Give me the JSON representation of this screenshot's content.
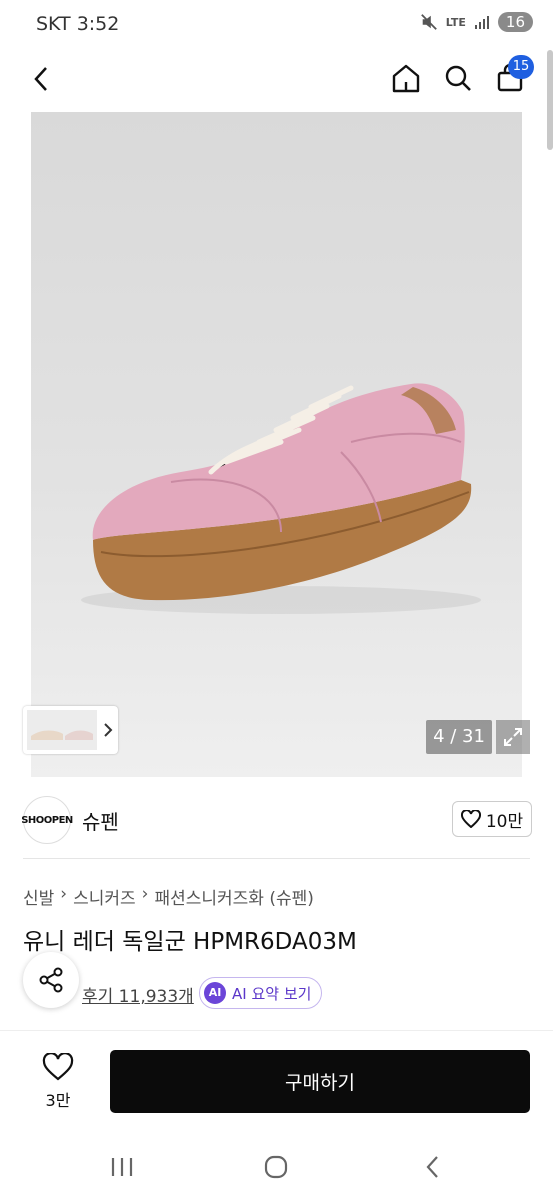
{
  "status_bar": {
    "carrier_time": "SKT 3:52",
    "network": "LTE",
    "battery": "16"
  },
  "header": {
    "cart_count": "15"
  },
  "gallery": {
    "counter": "4 / 31"
  },
  "brand": {
    "logo_text": "SHOOPEN",
    "name": "슈펜",
    "likes": "10만"
  },
  "breadcrumb": [
    "신발",
    "스니커즈",
    "패션스니커즈화 (슈펜)"
  ],
  "product": {
    "title": "유니 레더 독일군 HPMR6DA03M"
  },
  "reviews": {
    "label": "후기 11,933개"
  },
  "ai_summary": {
    "badge": "AI",
    "label": "AI 요약 보기"
  },
  "bottom_bar": {
    "likes": "3만",
    "buy_label": "구매하기"
  },
  "colors": {
    "accent_blue": "#1f5fe0",
    "ai_purple": "#6b45d8",
    "shoe_pink": "#e3a9bd",
    "sole_gum": "#b07a45"
  }
}
